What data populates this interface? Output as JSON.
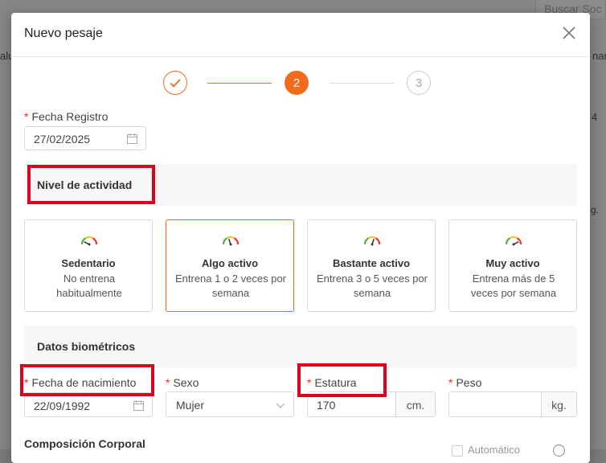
{
  "background": {
    "search_placeholder": "Buscar Soc",
    "left_fragment": "alu",
    "right_fragment": "nam",
    "right_fragment2": "g.",
    "right_icon": "4"
  },
  "modal": {
    "title": "Nuevo pesaje",
    "close_icon": "close-icon"
  },
  "steps": [
    {
      "label": "",
      "state": "done"
    },
    {
      "label": "2",
      "state": "active"
    },
    {
      "label": "3",
      "state": "pending"
    }
  ],
  "fecha_registro": {
    "label": "Fecha Registro",
    "value": "27/02/2025"
  },
  "nivel_actividad": {
    "title": "Nivel de actividad",
    "selected": 1,
    "options": [
      {
        "title": "Sedentario",
        "desc": "No entrena habitualmente",
        "level": 0.15
      },
      {
        "title": "Algo activo",
        "desc": "Entrena 1 o 2 veces por semana",
        "level": 0.4
      },
      {
        "title": "Bastante activo",
        "desc": "Entrena 3 o 5 veces por semana",
        "level": 0.6
      },
      {
        "title": "Muy activo",
        "desc": "Entrena más de 5 veces por semana",
        "level": 0.85
      }
    ]
  },
  "datos_biometricos": {
    "title": "Datos biométricos",
    "fecha_nacimiento": {
      "label": "Fecha de nacimiento",
      "value": "22/09/1992"
    },
    "sexo": {
      "label": "Sexo",
      "value": "Mujer"
    },
    "estatura": {
      "label": "Estatura",
      "value": "170",
      "unit": "cm."
    },
    "peso": {
      "label": "Peso",
      "value": "",
      "unit": "kg."
    }
  },
  "partial_section": {
    "title": "Composición Corporal",
    "check_label": "Automático"
  },
  "colors": {
    "accent": "#f26b1d",
    "highlight": "#e0001b",
    "required": "#f5222d"
  }
}
